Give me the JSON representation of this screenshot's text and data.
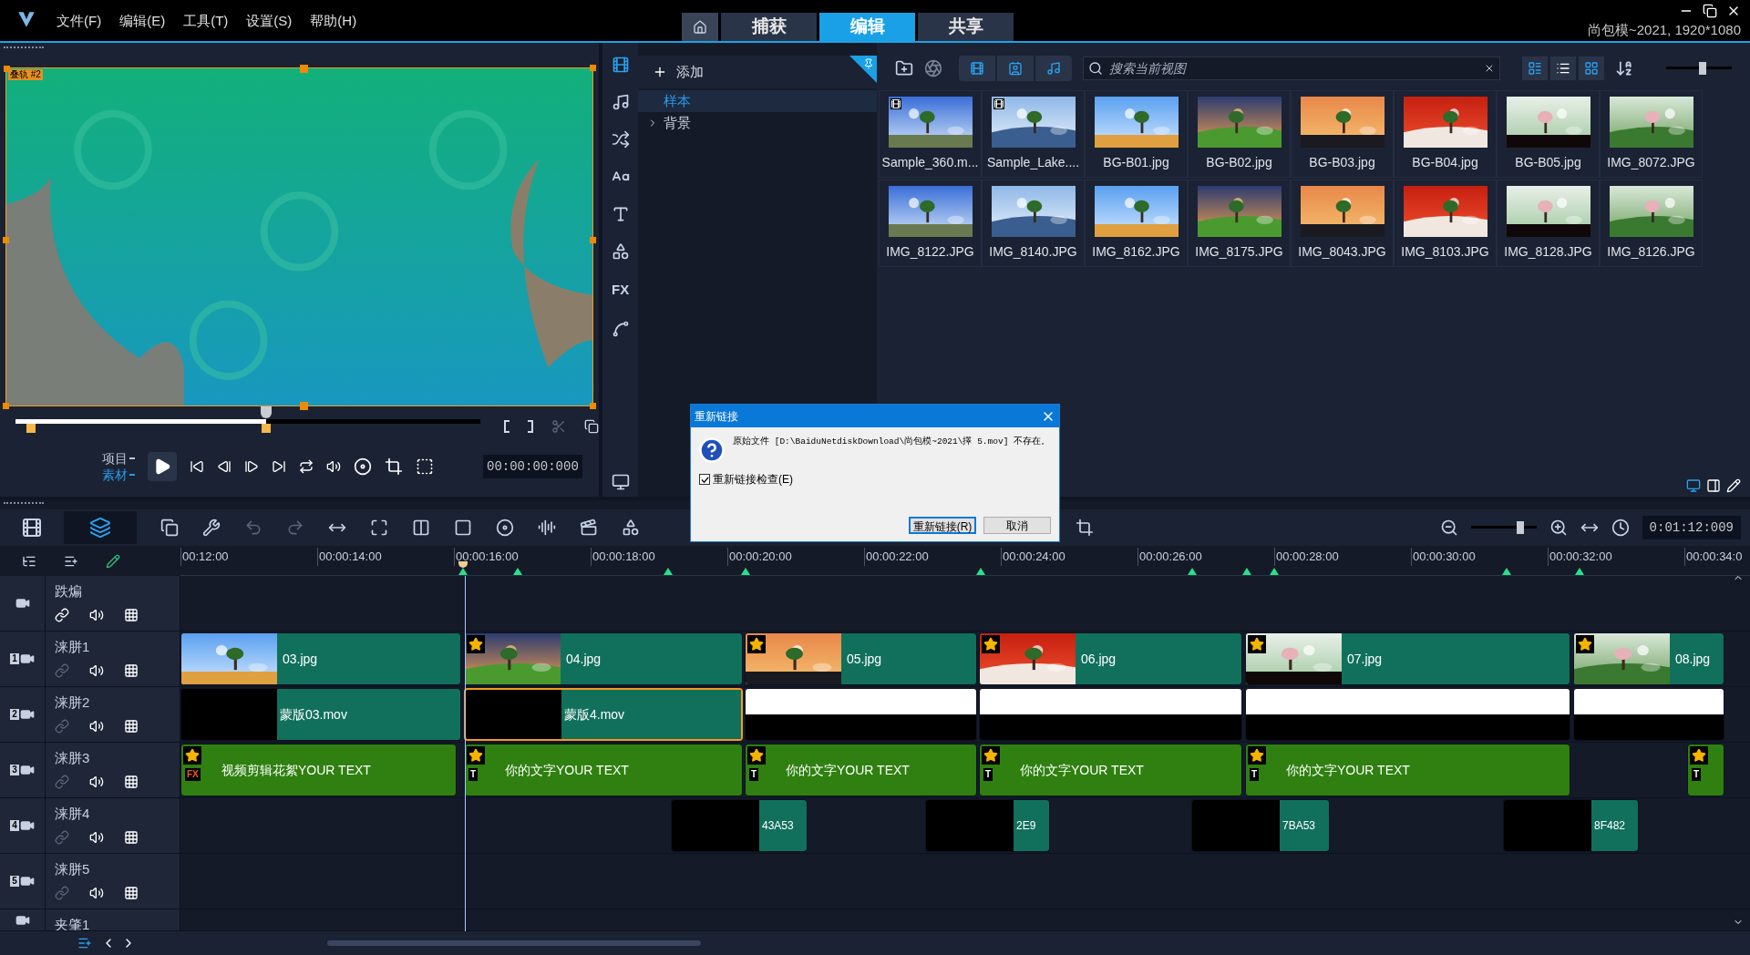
{
  "menu": [
    "文件(F)",
    "编辑(E)",
    "工具(T)",
    "设置(S)",
    "帮助(H)"
  ],
  "tabs": [
    {
      "label": "捕获",
      "selected": false
    },
    {
      "label": "编辑",
      "selected": true
    },
    {
      "label": "共享",
      "selected": false
    }
  ],
  "project_info": "尚包模~2021, 1920*1080",
  "preview": {
    "track_label": "叠轨 #2",
    "scrub": {
      "level": 0.54
    },
    "modes": [
      {
        "label": "项目",
        "selected": false
      },
      {
        "label": "素材",
        "selected": true
      }
    ],
    "timecode": "00:00:00:000"
  },
  "library": {
    "add_label": "添加",
    "fx_label": "FX",
    "folders": [
      {
        "label": "样本",
        "selected": true,
        "expandable": false
      },
      {
        "label": "背景",
        "selected": false,
        "expandable": true
      }
    ],
    "search": {
      "placeholder": "搜索当前视图"
    },
    "size": {
      "level": 0.55
    },
    "items": [
      {
        "name": "Sample_360.m...",
        "kind": "video"
      },
      {
        "name": "Sample_Lake....",
        "kind": "video"
      },
      {
        "name": "BG-B01.jpg"
      },
      {
        "name": "BG-B02.jpg"
      },
      {
        "name": "BG-B03.jpg"
      },
      {
        "name": "BG-B04.jpg"
      },
      {
        "name": "BG-B05.jpg"
      },
      {
        "name": "IMG_8072.JPG"
      },
      {
        "name": "IMG_8122.JPG"
      },
      {
        "name": "IMG_8140.JPG"
      },
      {
        "name": "IMG_8162.JPG"
      },
      {
        "name": "IMG_8175.JPG"
      },
      {
        "name": "IMG_8043.JPG"
      },
      {
        "name": "IMG_8103.JPG"
      },
      {
        "name": "IMG_8128.JPG"
      },
      {
        "name": "IMG_8126.JPG"
      }
    ]
  },
  "timeline": {
    "zoom": {
      "level": 0.75
    },
    "timecode": "0:01:12:009",
    "ruler": [
      "00:12:00",
      "00:00:14:00",
      "00:00:16:00",
      "00:00:18:00",
      "00:00:20:00",
      "00:00:22:00",
      "00:00:24:00",
      "00:00:26:00",
      "00:00:28:00",
      "00:00:30:00",
      "00:00:32:00",
      "00:00:34:0"
    ],
    "tracks": [
      {
        "name": "跌煸"
      },
      {
        "name": "涞胼1",
        "badge": "1",
        "clips": [
          {
            "label": "03.jpg",
            "marked": false,
            "selected": false
          },
          {
            "label": "04.jpg",
            "marked": true,
            "selected": false
          },
          {
            "label": "05.jpg",
            "marked": true,
            "selected": false
          },
          {
            "label": "06.jpg",
            "marked": true,
            "selected": false
          },
          {
            "label": "07.jpg",
            "marked": true,
            "selected": false
          },
          {
            "label": "08.jpg",
            "marked": true,
            "selected": false
          }
        ]
      },
      {
        "name": "涞胼2",
        "badge": "2",
        "clips": [
          {
            "label": "蒙版03.mov",
            "kind": "mask",
            "marked": false,
            "selected": false
          },
          {
            "label": "蒙版4.mov",
            "kind": "mask",
            "marked": false,
            "selected": true
          },
          {
            "kind": "blank",
            "selected": false
          },
          {
            "kind": "blank",
            "selected": false
          },
          {
            "kind": "blank",
            "selected": false
          },
          {
            "kind": "blank",
            "selected": false
          }
        ]
      },
      {
        "name": "涞胼3",
        "badge": "3",
        "clips": [
          {
            "label": "视频剪辑花絮YOUR TEXT",
            "kind": "title",
            "tag": "FX",
            "marked": true,
            "selected": false
          },
          {
            "label": "你的文字YOUR TEXT",
            "kind": "title",
            "tag": "T",
            "marked": true,
            "selected": false
          },
          {
            "label": "你的文字YOUR TEXT",
            "kind": "title",
            "tag": "T",
            "marked": true,
            "selected": false
          },
          {
            "label": "你的文字YOUR TEXT",
            "kind": "title",
            "tag": "T",
            "marked": true,
            "selected": false
          },
          {
            "label": "你的文字YOUR TEXT",
            "kind": "title",
            "tag": "T",
            "marked": true,
            "selected": false
          },
          {
            "kind": "title",
            "tag": "T",
            "marked": true,
            "selected": false
          }
        ]
      },
      {
        "name": "涞胼4",
        "badge": "4",
        "clips": [
          {
            "label": "43A53",
            "kind": "mask",
            "marked": false,
            "selected": false
          },
          {
            "label": "2E9",
            "kind": "mask",
            "marked": false,
            "selected": false
          },
          {
            "label": "7BA53",
            "kind": "mask",
            "marked": false,
            "selected": false
          },
          {
            "label": "8F482",
            "kind": "mask",
            "marked": false,
            "selected": false
          }
        ]
      },
      {
        "name": "涞胼5",
        "badge": "5"
      },
      {
        "name": "夹肇1"
      }
    ]
  },
  "dialog": {
    "title": "重新链接",
    "message": "原始文件 [D:\\BaiduNetdiskDownload\\尚包模~2021\\擇  5.mov] 不存在。",
    "checkbox": {
      "label": "重新链接检查(E)",
      "checked": true
    },
    "buttons": [
      {
        "label": "重新链接(R)",
        "selected": true
      },
      {
        "label": "取消",
        "selected": false
      }
    ]
  }
}
